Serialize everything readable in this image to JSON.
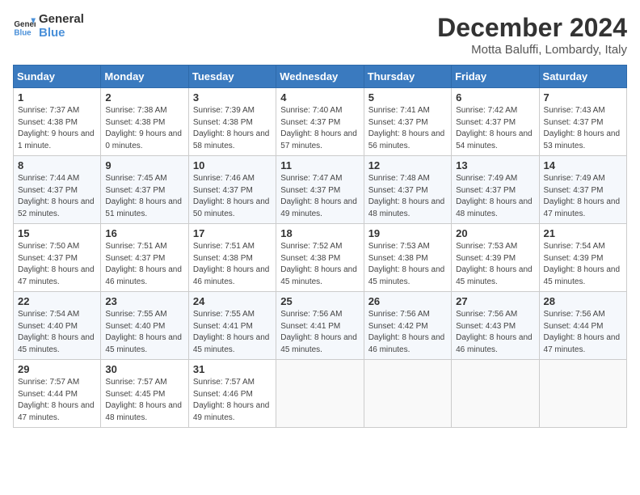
{
  "header": {
    "logo_line1": "General",
    "logo_line2": "Blue",
    "month": "December 2024",
    "location": "Motta Baluffi, Lombardy, Italy"
  },
  "weekdays": [
    "Sunday",
    "Monday",
    "Tuesday",
    "Wednesday",
    "Thursday",
    "Friday",
    "Saturday"
  ],
  "weeks": [
    [
      {
        "day": "1",
        "sunrise": "7:37 AM",
        "sunset": "4:38 PM",
        "daylight": "9 hours and 1 minute."
      },
      {
        "day": "2",
        "sunrise": "7:38 AM",
        "sunset": "4:38 PM",
        "daylight": "9 hours and 0 minutes."
      },
      {
        "day": "3",
        "sunrise": "7:39 AM",
        "sunset": "4:38 PM",
        "daylight": "8 hours and 58 minutes."
      },
      {
        "day": "4",
        "sunrise": "7:40 AM",
        "sunset": "4:37 PM",
        "daylight": "8 hours and 57 minutes."
      },
      {
        "day": "5",
        "sunrise": "7:41 AM",
        "sunset": "4:37 PM",
        "daylight": "8 hours and 56 minutes."
      },
      {
        "day": "6",
        "sunrise": "7:42 AM",
        "sunset": "4:37 PM",
        "daylight": "8 hours and 54 minutes."
      },
      {
        "day": "7",
        "sunrise": "7:43 AM",
        "sunset": "4:37 PM",
        "daylight": "8 hours and 53 minutes."
      }
    ],
    [
      {
        "day": "8",
        "sunrise": "7:44 AM",
        "sunset": "4:37 PM",
        "daylight": "8 hours and 52 minutes."
      },
      {
        "day": "9",
        "sunrise": "7:45 AM",
        "sunset": "4:37 PM",
        "daylight": "8 hours and 51 minutes."
      },
      {
        "day": "10",
        "sunrise": "7:46 AM",
        "sunset": "4:37 PM",
        "daylight": "8 hours and 50 minutes."
      },
      {
        "day": "11",
        "sunrise": "7:47 AM",
        "sunset": "4:37 PM",
        "daylight": "8 hours and 49 minutes."
      },
      {
        "day": "12",
        "sunrise": "7:48 AM",
        "sunset": "4:37 PM",
        "daylight": "8 hours and 48 minutes."
      },
      {
        "day": "13",
        "sunrise": "7:49 AM",
        "sunset": "4:37 PM",
        "daylight": "8 hours and 48 minutes."
      },
      {
        "day": "14",
        "sunrise": "7:49 AM",
        "sunset": "4:37 PM",
        "daylight": "8 hours and 47 minutes."
      }
    ],
    [
      {
        "day": "15",
        "sunrise": "7:50 AM",
        "sunset": "4:37 PM",
        "daylight": "8 hours and 47 minutes."
      },
      {
        "day": "16",
        "sunrise": "7:51 AM",
        "sunset": "4:37 PM",
        "daylight": "8 hours and 46 minutes."
      },
      {
        "day": "17",
        "sunrise": "7:51 AM",
        "sunset": "4:38 PM",
        "daylight": "8 hours and 46 minutes."
      },
      {
        "day": "18",
        "sunrise": "7:52 AM",
        "sunset": "4:38 PM",
        "daylight": "8 hours and 45 minutes."
      },
      {
        "day": "19",
        "sunrise": "7:53 AM",
        "sunset": "4:38 PM",
        "daylight": "8 hours and 45 minutes."
      },
      {
        "day": "20",
        "sunrise": "7:53 AM",
        "sunset": "4:39 PM",
        "daylight": "8 hours and 45 minutes."
      },
      {
        "day": "21",
        "sunrise": "7:54 AM",
        "sunset": "4:39 PM",
        "daylight": "8 hours and 45 minutes."
      }
    ],
    [
      {
        "day": "22",
        "sunrise": "7:54 AM",
        "sunset": "4:40 PM",
        "daylight": "8 hours and 45 minutes."
      },
      {
        "day": "23",
        "sunrise": "7:55 AM",
        "sunset": "4:40 PM",
        "daylight": "8 hours and 45 minutes."
      },
      {
        "day": "24",
        "sunrise": "7:55 AM",
        "sunset": "4:41 PM",
        "daylight": "8 hours and 45 minutes."
      },
      {
        "day": "25",
        "sunrise": "7:56 AM",
        "sunset": "4:41 PM",
        "daylight": "8 hours and 45 minutes."
      },
      {
        "day": "26",
        "sunrise": "7:56 AM",
        "sunset": "4:42 PM",
        "daylight": "8 hours and 46 minutes."
      },
      {
        "day": "27",
        "sunrise": "7:56 AM",
        "sunset": "4:43 PM",
        "daylight": "8 hours and 46 minutes."
      },
      {
        "day": "28",
        "sunrise": "7:56 AM",
        "sunset": "4:44 PM",
        "daylight": "8 hours and 47 minutes."
      }
    ],
    [
      {
        "day": "29",
        "sunrise": "7:57 AM",
        "sunset": "4:44 PM",
        "daylight": "8 hours and 47 minutes."
      },
      {
        "day": "30",
        "sunrise": "7:57 AM",
        "sunset": "4:45 PM",
        "daylight": "8 hours and 48 minutes."
      },
      {
        "day": "31",
        "sunrise": "7:57 AM",
        "sunset": "4:46 PM",
        "daylight": "8 hours and 49 minutes."
      },
      null,
      null,
      null,
      null
    ]
  ],
  "labels": {
    "sunrise": "Sunrise:",
    "sunset": "Sunset:",
    "daylight": "Daylight:"
  }
}
